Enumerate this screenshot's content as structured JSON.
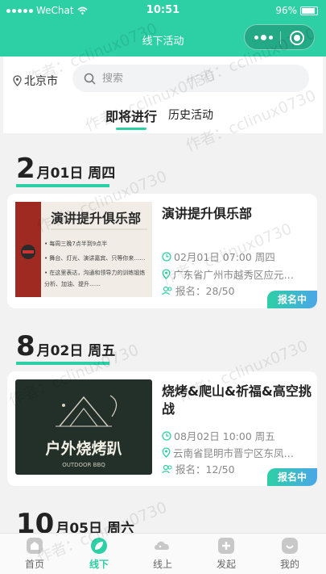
{
  "status_bar": {
    "carrier": "WeChat",
    "time": "10:51",
    "battery": "96%"
  },
  "nav": {
    "title": "线下活动"
  },
  "header": {
    "city": "北京市",
    "search_placeholder": "搜索",
    "tabs": [
      {
        "label": "即将进行",
        "active": true
      },
      {
        "label": "历史活动",
        "active": false
      }
    ]
  },
  "events": [
    {
      "date_big": "2",
      "date_rest": "月01日 周四",
      "title": "演讲提升俱乐部",
      "thumb_title": "演讲提升俱乐部",
      "thumb_lines": [
        "• 每周三晚7点半到9点半",
        "• 舞台、灯光、演讲嘉宾、只等你来……",
        "• 在这里表达，沟通和领导力的训练锻炼",
        "  分析、加油、提升……"
      ],
      "time": "02月01日 07:00 周四",
      "location": "广东省广州市越秀区应元…",
      "signup": "报名：28/50",
      "status": "报名中"
    },
    {
      "date_big": "8",
      "date_rest": "月02日 周五",
      "title": "烧烤&爬山&祈福&高空挑战",
      "thumb_title": "户外烧烤趴",
      "thumb_sub": "OUTDOOR BBQ",
      "time": "08月02日 10:00 周五",
      "location": "云南省昆明市晋宁区东凤…",
      "signup": "报名：12/50",
      "status": "报名中"
    },
    {
      "date_big": "10",
      "date_rest": "月05日 周六"
    }
  ],
  "tabbar": [
    {
      "label": "首页",
      "icon": "home-icon",
      "active": false
    },
    {
      "label": "线下",
      "icon": "leaf-icon",
      "active": true
    },
    {
      "label": "线上",
      "icon": "cloud-icon",
      "active": false
    },
    {
      "label": "发起",
      "icon": "plus-icon",
      "active": false
    },
    {
      "label": "我的",
      "icon": "smile-icon",
      "active": false
    }
  ],
  "watermark": "作者：cclinux0730",
  "colors": {
    "accent": "#2dcfa5",
    "badge_end": "#4aa6e8"
  }
}
